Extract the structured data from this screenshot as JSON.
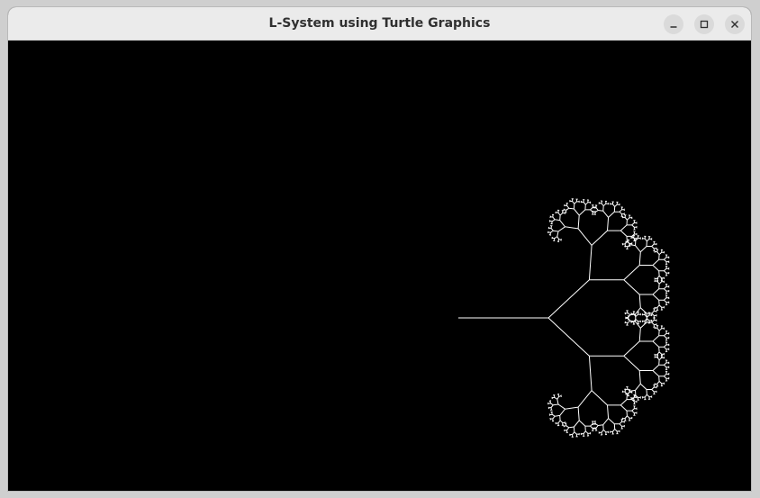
{
  "window": {
    "title": "L-System using Turtle Graphics"
  },
  "titlebar": {
    "buttons": [
      {
        "name": "minimize-button",
        "icon": "minimize-icon"
      },
      {
        "name": "maximize-button",
        "icon": "maximize-icon"
      },
      {
        "name": "close-button",
        "icon": "close-icon"
      }
    ]
  },
  "canvas": {
    "background": "#000000",
    "stroke_color": "#ffffff",
    "drawing": "fractal-binary-tree"
  }
}
